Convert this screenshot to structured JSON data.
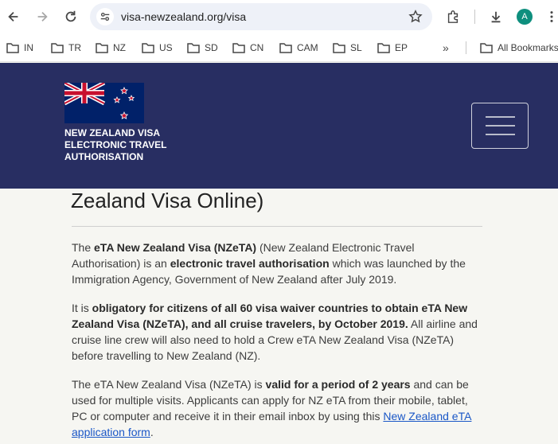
{
  "browser": {
    "url": "visa-newzealand.org/visa",
    "avatar_letter": "A",
    "bookmarks": [
      {
        "label": "IN"
      },
      {
        "label": "TR"
      },
      {
        "label": "NZ"
      },
      {
        "label": "US"
      },
      {
        "label": "SD"
      },
      {
        "label": "CN"
      },
      {
        "label": "CAM"
      },
      {
        "label": "SL"
      },
      {
        "label": "EP"
      }
    ],
    "overflow_label": "»",
    "all_bookmarks": "All Bookmarks"
  },
  "site": {
    "brand_line1": "NEW ZEALAND VISA",
    "brand_line2": "ELECTRONIC TRAVEL",
    "brand_line3": "AUTHORISATION",
    "header_color": "#282e62"
  },
  "content": {
    "heading": "Zealand Visa Online)",
    "p1": {
      "t1": "The ",
      "b1": "eTA New Zealand Visa (NZeTA)",
      "t2": " (New Zealand Electronic Travel Authorisation) is an ",
      "b2": "electronic travel authorisation",
      "t3": " which was launched by the Immigration Agency, Government of New Zealand after July 2019."
    },
    "p2": {
      "t1": "It is ",
      "b1": "obligatory for citizens of all 60 visa waiver countries to obtain eTA New Zealand Visa (NZeTA), and all cruise travelers, by October 2019.",
      "t2": " All airline and cruise line crew will also need to hold a Crew eTA New Zealand Visa (NZeTA) before travelling to New Zealand (NZ)."
    },
    "p3": {
      "t1": "The eTA New Zealand Visa (NZeTA) is ",
      "b1": "valid for a period of 2 years",
      "t2": " and can be used for multiple visits. Applicants can apply for NZ eTA from their mobile, tablet, PC or computer and receive it in their email inbox by using this ",
      "link": "New Zealand eTA application form",
      "t3": "."
    }
  }
}
